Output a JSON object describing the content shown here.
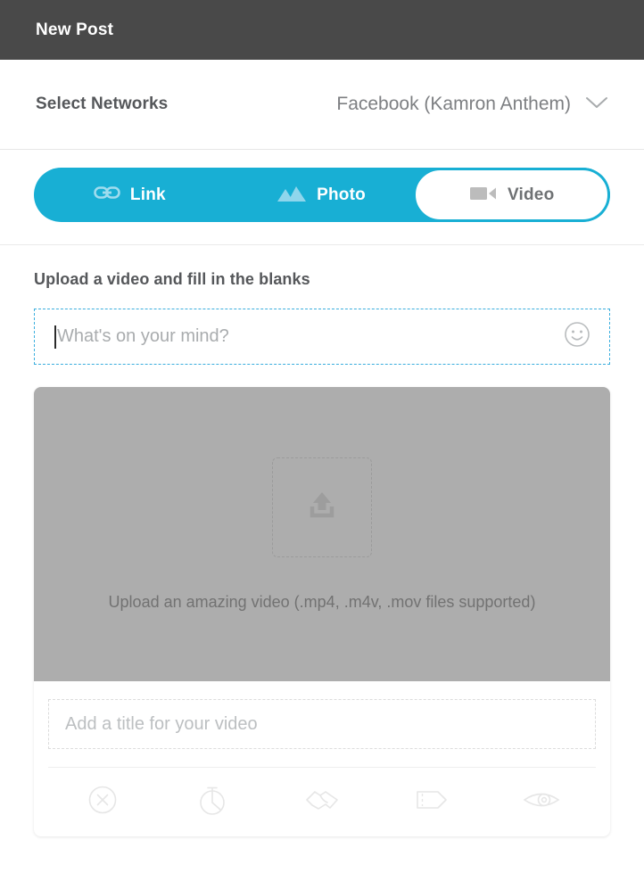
{
  "header": {
    "title": "New Post"
  },
  "networks": {
    "label": "Select Networks",
    "selected": "Facebook (Kamron Anthem)",
    "chevron_icon": "chevron-down-icon"
  },
  "tabs": [
    {
      "label": "Link",
      "icon": "link-icon",
      "active": false
    },
    {
      "label": "Photo",
      "icon": "photo-icon",
      "active": false
    },
    {
      "label": "Video",
      "icon": "video-icon",
      "active": true
    }
  ],
  "compose": {
    "section_title": "Upload a video and fill in the blanks",
    "message_placeholder": "What's on your mind?",
    "message_value": "",
    "emoji_icon": "smiley-icon"
  },
  "video_card": {
    "upload_icon": "upload-icon",
    "drop_caption": "Upload an amazing video (.mp4, .m4v, .mov files supported)",
    "title_placeholder": "Add a title for your video",
    "title_value": "",
    "actions": [
      {
        "name": "remove-icon",
        "tooltip": "Remove"
      },
      {
        "name": "schedule-icon",
        "tooltip": "Schedule"
      },
      {
        "name": "handshake-icon",
        "tooltip": "Partner"
      },
      {
        "name": "tag-icon",
        "tooltip": "Tag"
      },
      {
        "name": "preview-icon",
        "tooltip": "Preview"
      }
    ]
  },
  "colors": {
    "header_bg": "#494949",
    "accent": "#18AFD4",
    "dashed_accent": "#3AAEDE",
    "drop_bg": "#adadad",
    "text_dark": "#55575a",
    "text_muted": "#a9acae"
  }
}
